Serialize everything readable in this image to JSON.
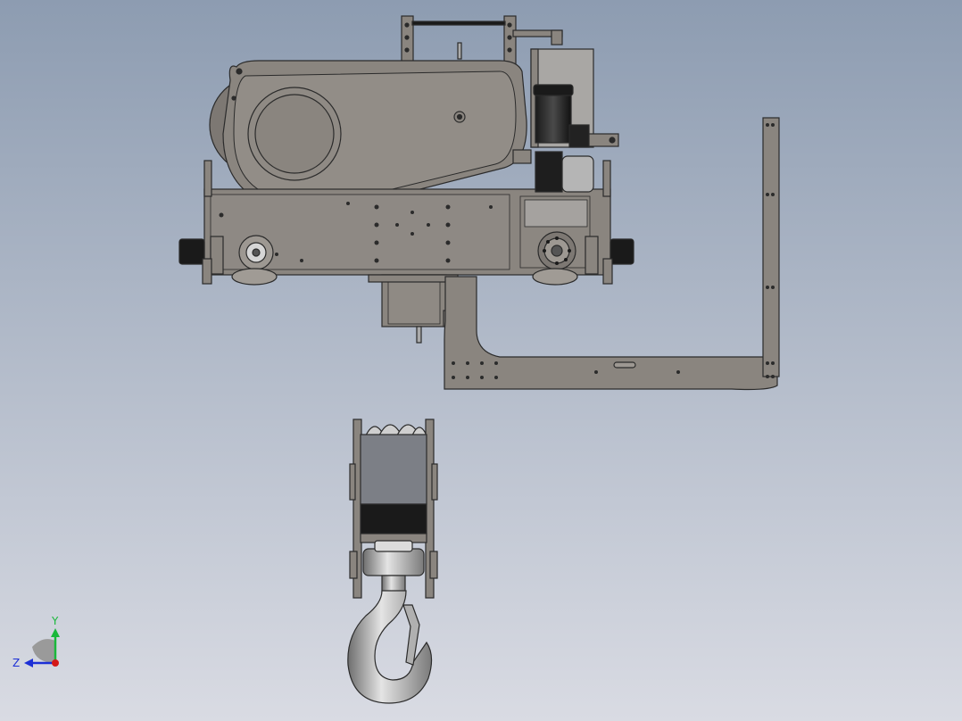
{
  "viewport": {
    "background_top": "#8d9cb1",
    "background_bottom": "#d9dbe3",
    "part_fill": "#8a857f",
    "part_stroke": "#2b2b2b",
    "dark_fill": "#1a1a1a",
    "block_fill": "#7c7f86"
  },
  "triad": {
    "y_label": "Y",
    "z_label": "Z",
    "y_color": "#19b83a",
    "z_color": "#1c2fd6",
    "x_color": "#d41818"
  }
}
